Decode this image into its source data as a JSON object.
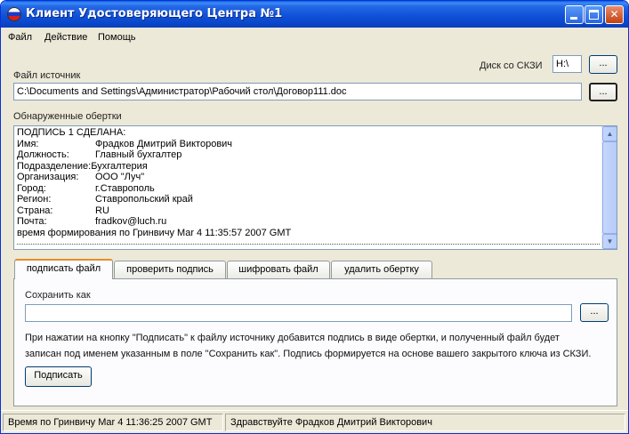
{
  "window": {
    "title": "Клиент Удостоверяющего Центра №1"
  },
  "menu": {
    "items": [
      "Файл",
      "Действие",
      "Помощь"
    ]
  },
  "disk": {
    "label": "Диск со СКЗИ",
    "value": "H:\\",
    "browse_label": "..."
  },
  "source": {
    "label": "Файл источник",
    "value": "C:\\Documents and Settings\\Администратор\\Рабочий стол\\Договор111.doc",
    "browse_label": "..."
  },
  "wrappers": {
    "label": "Обнаруженные обертки",
    "header": "ПОДПИСЬ 1    СДЕЛАНА:",
    "fields": [
      {
        "key": "Имя:",
        "value": "Фрадков Дмитрий Викторович"
      },
      {
        "key": "Должность:",
        "value": "Главный бухгалтер"
      },
      {
        "key": "Подразделение:",
        "value": "Бухгалтерия"
      },
      {
        "key": "Организация:",
        "value": "ООО \"Луч\""
      },
      {
        "key": "Город:",
        "value": "г.Ставрополь"
      },
      {
        "key": "Регион:",
        "value": "Ставропольский край"
      },
      {
        "key": "Страна:",
        "value": "RU"
      },
      {
        "key": "Почта:",
        "value": "fradkov@luch.ru"
      }
    ],
    "footer": "время формирования по Гринвичу Mar  4 11:35:57 2007 GMT"
  },
  "tabs": [
    {
      "label": "подписать файл",
      "active": true
    },
    {
      "label": "проверить подпись",
      "active": false
    },
    {
      "label": "шифровать файл",
      "active": false
    },
    {
      "label": "удалить обертку",
      "active": false
    }
  ],
  "panel": {
    "save_as_label": "Сохранить как",
    "save_as_value": "",
    "browse_label": "...",
    "hint_line1": "При нажатии на кнопку \"Подписать\"  к файлу источнику добавится подпись в виде обертки, и полученный файл будет",
    "hint_line2": "записан под именем указанным в поле \"Сохранить как\". Подпись формируется на основе вашего закрытого ключа из СКЗИ.",
    "sign_button": "Подписать"
  },
  "status": {
    "time": "Время по Гринвичу Mar  4 11:36:25 2007 GMT",
    "greeting": "Здравствуйте Фрадков Дмитрий Викторович"
  },
  "colors": {
    "titlebar": "#0a4fd6",
    "accent_tab": "#e68b2c",
    "window_bg": "#ece9d8"
  },
  "icons": {
    "app": "flag-icon",
    "minimize": "minimize-icon",
    "maximize": "maximize-icon",
    "close": "close-icon"
  }
}
